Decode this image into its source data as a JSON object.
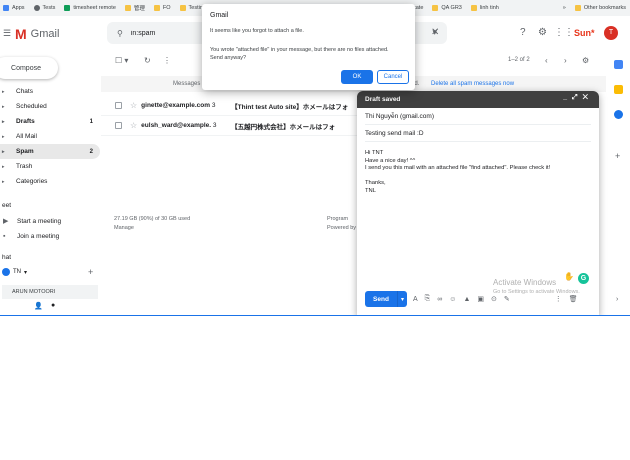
{
  "bookmarks": [
    {
      "label": "Apps"
    },
    {
      "label": "Tests"
    },
    {
      "label": "timesheet remote"
    },
    {
      "label": "管理"
    },
    {
      "label": "FO"
    },
    {
      "label": "Testing"
    },
    {
      "label": "cate"
    },
    {
      "label": "QA GR3"
    },
    {
      "label": "linh tinh"
    }
  ],
  "bookmarks_more": "»",
  "bookmarks_other": "Other bookmarks",
  "header": {
    "app_name": "Gmail",
    "search_value": "in:spam",
    "brand": "Sun*",
    "avatar_letter": "T"
  },
  "sidebar": {
    "compose_label": "Compose",
    "items": [
      {
        "label": "Chats",
        "count": ""
      },
      {
        "label": "Scheduled",
        "count": ""
      },
      {
        "label": "Drafts",
        "count": "1"
      },
      {
        "label": "All Mail",
        "count": ""
      },
      {
        "label": "Spam",
        "count": "2"
      },
      {
        "label": "Trash",
        "count": ""
      },
      {
        "label": "Categories",
        "count": ""
      }
    ],
    "meet_section": "eet",
    "meet_items": [
      {
        "label": "Start a meeting"
      },
      {
        "label": "Join a meeting"
      }
    ],
    "hangouts_section": "hat",
    "hangouts_user": "TN",
    "hangouts_contact": "ARUN MOTOORI"
  },
  "toolbar": {
    "pager": "1–2 of 2"
  },
  "infobar": {
    "message": "Messages",
    "tail": "nd.",
    "link": "Delete all spam messages now"
  },
  "mail_rows": [
    {
      "sender": "ginette@example.com",
      "count": "3",
      "subject": "【Thint test Auto site】ホメールはフォ"
    },
    {
      "sender": "eulsh_ward@example.",
      "count": "3",
      "subject": "【五越円株式会社】ホメールはフォ"
    }
  ],
  "footer": {
    "storage": "27.19 GB (90%) of 30 GB used",
    "manage": "Manage",
    "program": "Program",
    "powered": "Powered by"
  },
  "draft": {
    "title": "Draft saved",
    "to": "Thi Nguyễn (gmail.com)",
    "subject": "Testing send mail :D",
    "body": [
      "Hi TNT",
      "Have a nice day! ^^",
      "I send you this mail with an attached file \"find attached\". Please check it!",
      "",
      "Thanks,",
      "TNL"
    ],
    "send_label": "Send"
  },
  "watermark": {
    "title": "Activate Windows",
    "subtitle": "Go to Settings to activate Windows."
  },
  "dialog": {
    "title": "Gmail",
    "line1": "It seems like you forgot to attach a file.",
    "line2": "You wrote \"attached file\" in your message, but there are no files attached. Send anyway?",
    "ok_label": "OK",
    "cancel_label": "Cancel"
  },
  "colors": {
    "primary": "#1a73e8",
    "gmail_red": "#d93025",
    "brand_red": "#e8351b"
  }
}
